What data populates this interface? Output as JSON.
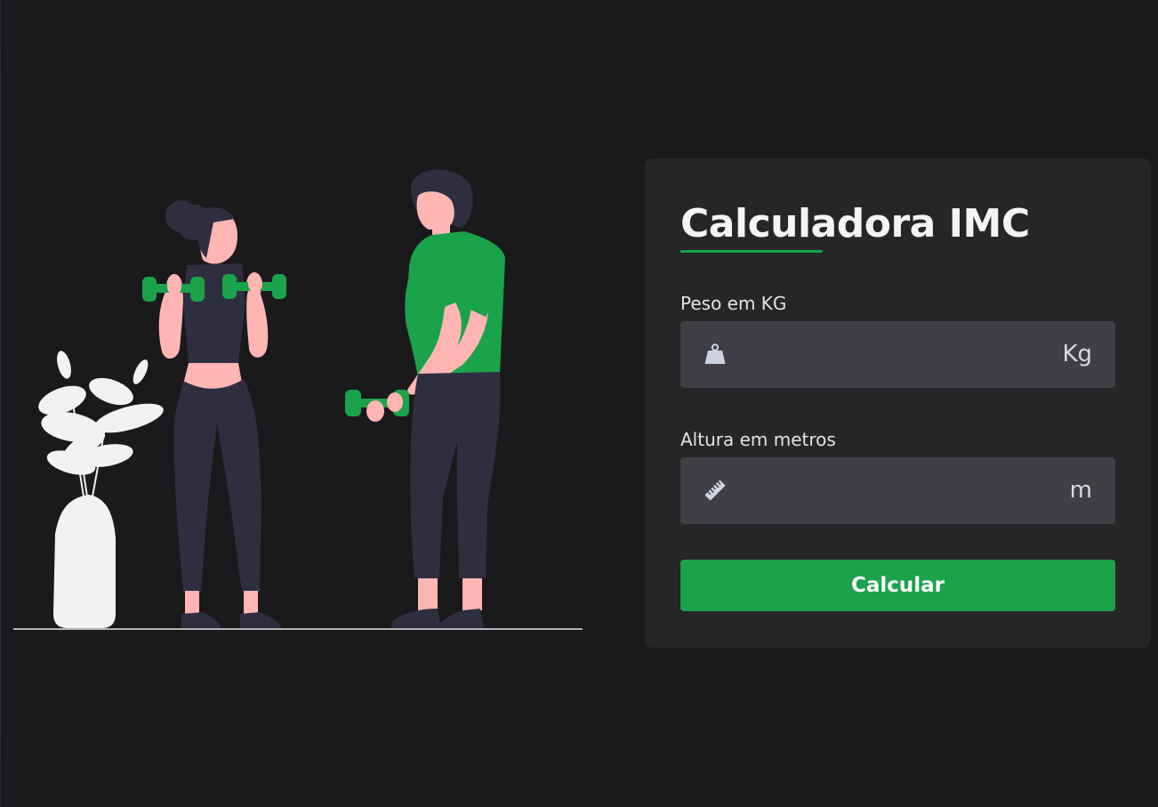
{
  "card": {
    "title": "Calculadora IMC",
    "weight": {
      "label": "Peso em KG",
      "value": "",
      "unit": "Kg",
      "icon": "weight-icon"
    },
    "height": {
      "label": "Altura em metros",
      "value": "",
      "unit": "m",
      "icon": "ruler-icon"
    },
    "button_label": "Calcular"
  },
  "colors": {
    "background": "#1a191c",
    "card": "#262626",
    "input": "#3f3f45",
    "accent": "#1aa34a",
    "skin": "#ffb6b3",
    "clothing_dark": "#2f2e41",
    "plant": "#f2f2f2"
  }
}
